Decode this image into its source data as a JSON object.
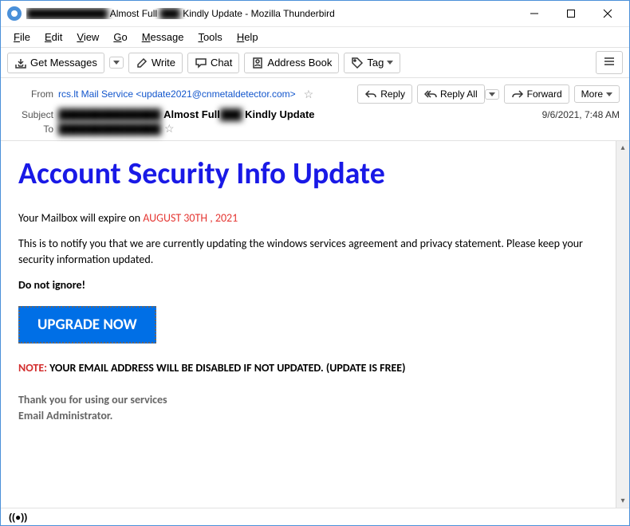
{
  "titlebar": {
    "redacted1": "████████████",
    "part1": " Almost Full ",
    "redacted2": "███",
    "part2": " Kindly Update - Mozilla Thunderbird"
  },
  "menu": {
    "file": "File",
    "edit": "Edit",
    "view": "View",
    "go": "Go",
    "message": "Message",
    "tools": "Tools",
    "help": "Help"
  },
  "toolbar": {
    "get": "Get Messages",
    "write": "Write",
    "chat": "Chat",
    "addressbook": "Address Book",
    "tag": "Tag"
  },
  "header": {
    "from_lbl": "From",
    "from_val": "rcs.lt Mail Service <update2021@cnmetaldetector.com>",
    "reply": "Reply",
    "replyall": "Reply All",
    "forward": "Forward",
    "more": "More",
    "subject_lbl": "Subject",
    "subject_redacted": "██████████████",
    "subject_part1": " Almost Full",
    "subject_redacted2": "███",
    "subject_part2": " Kindly Update",
    "date": "9/6/2021, 7:48 AM",
    "to_lbl": "To",
    "to_redacted": "██████████████"
  },
  "body": {
    "title": "Account Security Info Update",
    "line1_a": "Your Mailbox will expire on ",
    "line1_b": "AUGUST  30TH , 2021",
    "para": "This is to notify you that we are currently updating the windows services agreement and privacy statement. Please keep your security information updated.",
    "warn": "Do not ignore!",
    "upgrade": "UPGRADE NOW",
    "note_lbl": "NOTE:",
    "note_txt": " YOUR EMAIL ADDRESS WILL BE DISABLED IF NOT UPDATED. (UPDATE IS FREE)",
    "thanks1": "Thank you for using our services",
    "thanks2": "Email Administrator."
  }
}
